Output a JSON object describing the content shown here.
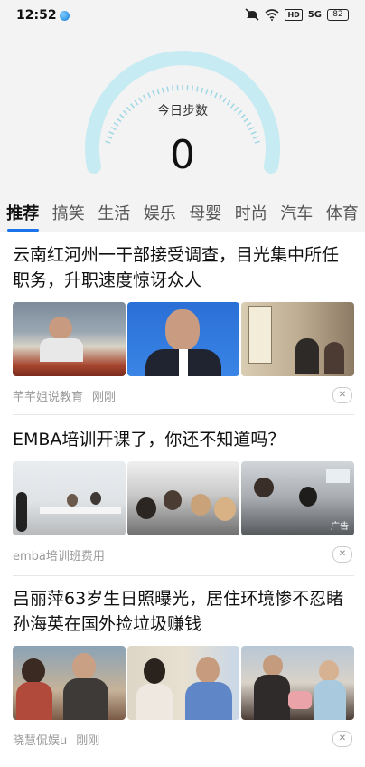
{
  "status_bar": {
    "time": "12:52",
    "icons": [
      "app-notification-icon",
      "mute-icon",
      "wifi-icon",
      "hd-icon",
      "signal-icon",
      "battery-icon"
    ],
    "hd": "HD",
    "signal": "5G",
    "battery": "82"
  },
  "steps": {
    "label": "今日步数",
    "value": "0",
    "accent": "#bfe7ef"
  },
  "tabs": [
    {
      "label": "推荐",
      "active": true
    },
    {
      "label": "搞笑"
    },
    {
      "label": "生活"
    },
    {
      "label": "娱乐"
    },
    {
      "label": "母婴"
    },
    {
      "label": "时尚"
    },
    {
      "label": "汽车"
    },
    {
      "label": "体育"
    }
  ],
  "articles": [
    {
      "title": "云南红河州一干部接受调查，目光集中所任职务，升职速度惊讶众人",
      "source": "芊芊姐说教育",
      "time": "刚刚"
    },
    {
      "title": "EMBA培训开课了，你还不知道吗？",
      "source": "emba培训班费用",
      "ad_label": "广告"
    },
    {
      "title": "吕丽萍63岁生日照曝光，居住环境惨不忍睹孙海英在国外捡垃圾赚钱",
      "source": "晓慧侃娱u",
      "time": "刚刚"
    }
  ],
  "close_glyph": "✕"
}
